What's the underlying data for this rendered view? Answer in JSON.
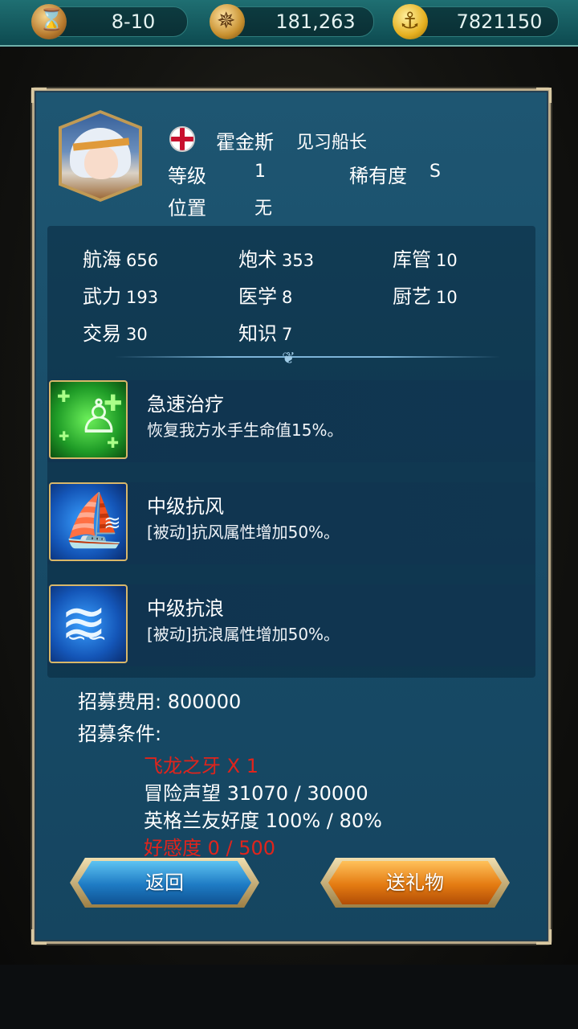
{
  "topbar": {
    "stage": "8-10",
    "compass_value": "181,263",
    "coins": "7821150"
  },
  "character": {
    "name": "霍金斯",
    "title": "见习船长",
    "level_label": "等级",
    "level_value": "1",
    "rarity_label": "稀有度",
    "rarity_value": "S",
    "position_label": "位置",
    "position_value": "无"
  },
  "stats": [
    {
      "label": "航海",
      "value": "656"
    },
    {
      "label": "炮术",
      "value": "353"
    },
    {
      "label": "库管",
      "value": "10"
    },
    {
      "label": "武力",
      "value": "193"
    },
    {
      "label": "医学",
      "value": "8"
    },
    {
      "label": "厨艺",
      "value": "10"
    },
    {
      "label": "交易",
      "value": "30"
    },
    {
      "label": "知识",
      "value": "7"
    }
  ],
  "skills": [
    {
      "name": "急速治疗",
      "desc": "恢复我方水手生命值15%。",
      "icon": "heal-icon"
    },
    {
      "name": "中级抗风",
      "desc": "[被动]抗风属性增加50%。",
      "icon": "sail-icon"
    },
    {
      "name": "中级抗浪",
      "desc": "[被动]抗浪属性增加50%。",
      "icon": "wave-icon"
    }
  ],
  "recruit": {
    "cost_text": "招募费用: 800000",
    "conditions_label": "招募条件:",
    "requirements": [
      {
        "text": "飞龙之牙 X 1",
        "color": "#e0241c"
      },
      {
        "text": "冒险声望 31070 / 30000",
        "color": "#ffffff"
      },
      {
        "text": "英格兰友好度 100% / 80%",
        "color": "#ffffff"
      },
      {
        "text": "好感度 0 / 500",
        "color": "#e0241c"
      }
    ]
  },
  "buttons": {
    "back": "返回",
    "gift": "送礼物"
  }
}
